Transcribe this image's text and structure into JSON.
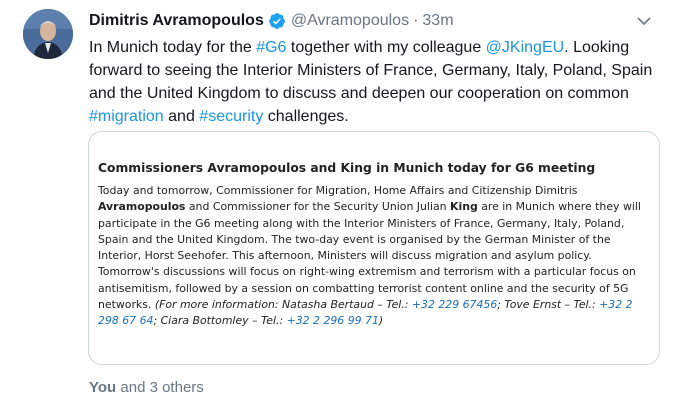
{
  "tweet": {
    "display_name": "Dimitris Avramopoulos",
    "handle": "@Avramopoulos",
    "separator": "·",
    "time": "33m",
    "text": {
      "p1": "In Munich today for the ",
      "tag_g6": "#G6",
      "p2": " together with my colleague ",
      "mention": "@JKingEU",
      "p3": ". Looking forward to seeing the Interior Ministers of France, Germany,  Italy, Poland, Spain and the United Kingdom to discuss and deepen our cooperation on common ",
      "tag_migration": "#migration",
      "p4": " and ",
      "tag_security": "#security",
      "p5": " challenges."
    }
  },
  "card": {
    "title": "Commissioners Avramopoulos and King in Munich today for G6 meeting",
    "b1": "Today and tomorrow, Commissioner for Migration, Home Affairs and Citizenship Dimitris ",
    "b2_bold": "Avramopoulos",
    "b3": " and Commissioner for the Security Union Julian ",
    "b4_bold": "King",
    "b5": " are in Munich where they will participate in the G6 meeting along with the Interior Ministers of France, Germany, Italy, Poland, Spain and the United Kingdom. The two-day event is organised by the German Minister of the Interior, Horst Seehofer. This afternoon, Ministers will discuss migration and asylum policy. Tomorrow's discussions will focus on right-wing extremism and terrorism with a particular focus on antisemitism, followed by a session on combatting terrorist content online and the security of 5G networks. ",
    "c1": "(For more information: Natasha Bertaud – Tel.: ",
    "c1_num": "+32 229 67456",
    "c2": "; Tove Ernst – Tel.: ",
    "c2_num": "+32 2 298 67 64",
    "c3": "; Ciara Bottomley – Tel.: ",
    "c3_num": "+32 2 296 99 71",
    "c4": ")"
  },
  "likes": {
    "you": "You",
    "others": " and 3 others"
  },
  "colors": {
    "link": "#1b95e0",
    "verified": "#1da1f2",
    "muted": "#657786",
    "card_border": "#ccd6dd"
  },
  "icons": {
    "verified": "verified-badge-icon",
    "chevron": "chevron-down-icon"
  }
}
